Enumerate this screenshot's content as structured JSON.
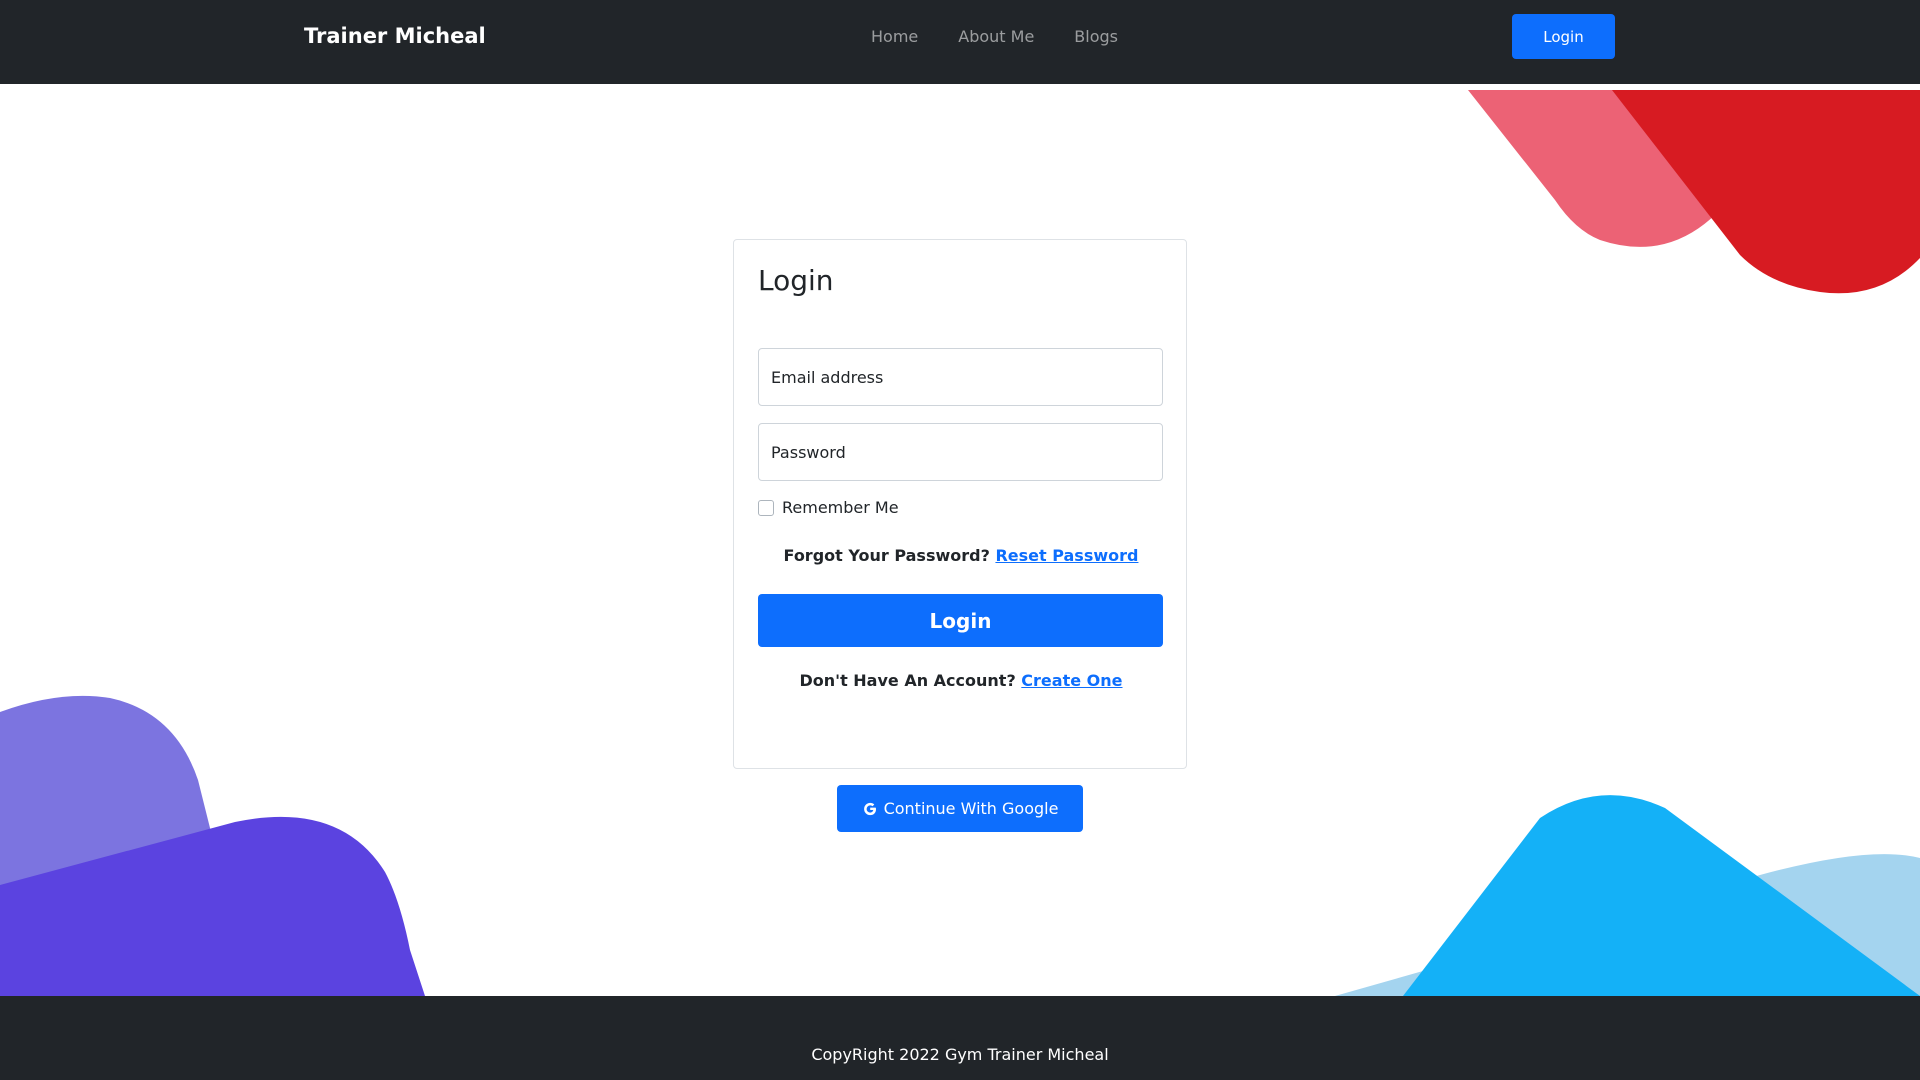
{
  "navbar": {
    "brand": "Trainer Micheal",
    "links": [
      "Home",
      "About Me",
      "Blogs"
    ],
    "login_label": "Login"
  },
  "login_card": {
    "title": "Login",
    "email_placeholder": "Email address",
    "password_placeholder": "Password",
    "remember_label": "Remember Me",
    "remember_checked": false,
    "forgot_text": "Forgot Your Password?",
    "reset_link": "Reset Password",
    "submit_label": "Login",
    "no_account_text": "Don't Have An Account?",
    "create_link": "Create One"
  },
  "google_button": {
    "label": "Continue With Google",
    "icon": "google-g-icon"
  },
  "footer": {
    "copyright": "CopyRight 2022 Gym Trainer Micheal"
  },
  "colors": {
    "primary": "#0d6efd",
    "dark": "#212529",
    "blob_red": "#e02128",
    "blob_pink": "#ec6275",
    "blob_purple": "#5b43e0",
    "blob_lavender": "#7c74e0",
    "blob_cyan": "#14b1f7",
    "blob_lightblue": "#a4d4ef"
  }
}
